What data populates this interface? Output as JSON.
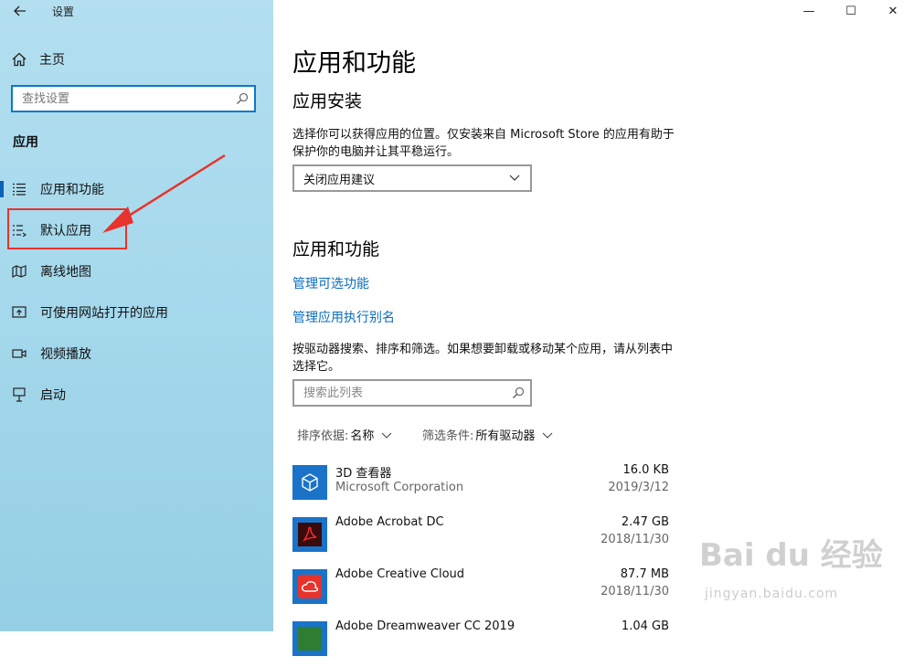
{
  "window": {
    "title": "设置",
    "minimize": "—",
    "maximize": "☐",
    "close": "✕"
  },
  "sidebar": {
    "home_label": "主页",
    "search_placeholder": "查找设置",
    "section_label": "应用",
    "items": [
      {
        "label": "应用和功能",
        "icon": "apps-list-icon",
        "selected": true
      },
      {
        "label": "默认应用",
        "icon": "default-apps-icon",
        "selected": false
      },
      {
        "label": "离线地图",
        "icon": "offline-map-icon",
        "selected": false
      },
      {
        "label": "可使用网站打开的应用",
        "icon": "website-app-icon",
        "selected": false
      },
      {
        "label": "视频播放",
        "icon": "video-icon",
        "selected": false
      },
      {
        "label": "启动",
        "icon": "startup-icon",
        "selected": false
      }
    ]
  },
  "main": {
    "title": "应用和功能",
    "install_heading": "应用安装",
    "install_desc_line1": "选择你可以获得应用的位置。仅安装来自 Microsoft Store 的应用有助于",
    "install_desc_line2": "保护你的电脑并让其平稳运行。",
    "install_dropdown": "关闭应用建议",
    "apps_heading": "应用和功能",
    "link_optional": "管理可选功能",
    "link_alias": "管理应用执行别名",
    "search_desc_line1": "按驱动器搜索、排序和筛选。如果想要卸载或移动某个应用，请从列表中",
    "search_desc_line2": "选择它。",
    "list_search_placeholder": "搜索此列表",
    "sort_label": "排序依据:",
    "sort_value": "名称",
    "filter_label": "筛选条件:",
    "filter_value": "所有驱动器",
    "apps": [
      {
        "name": "3D 查看器",
        "publisher": "Microsoft Corporation",
        "size": "16.0 KB",
        "date": "2019/3/12",
        "icon_color": "#1a73c9"
      },
      {
        "name": "Adobe Acrobat DC",
        "publisher": "",
        "size": "2.47 GB",
        "date": "2018/11/30",
        "icon_color": "#1a73c9"
      },
      {
        "name": "Adobe Creative Cloud",
        "publisher": "",
        "size": "87.7 MB",
        "date": "2018/11/30",
        "icon_color": "#1a73c9"
      },
      {
        "name": "Adobe Dreamweaver CC 2019",
        "publisher": "",
        "size": "1.04 GB",
        "date": "",
        "icon_color": "#1a73c9"
      }
    ]
  },
  "watermark": {
    "brand": "Bai du 经验",
    "url": "jingyan.baidu.com"
  },
  "colors": {
    "accent": "#0b63b7",
    "link": "#0a6cbd",
    "highlight": "#e8322c",
    "sidebar_bg": "#a6d9ec"
  }
}
